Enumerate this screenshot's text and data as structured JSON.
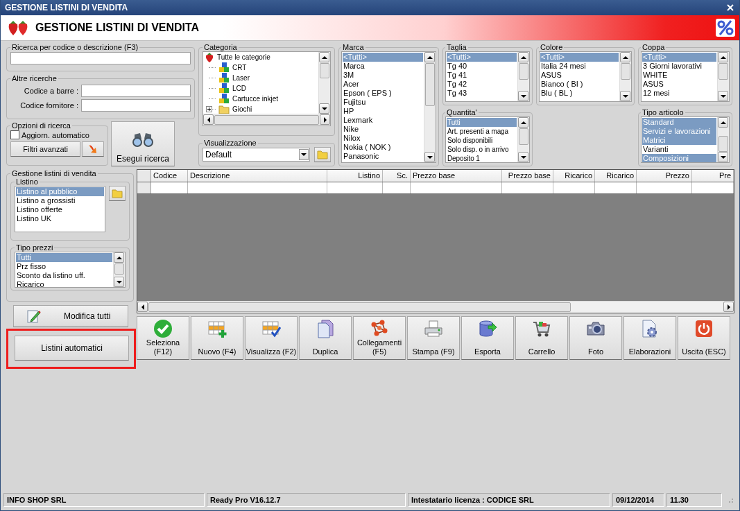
{
  "window": {
    "title": "GESTIONE LISTINI DI VENDITA"
  },
  "header": {
    "title": "GESTIONE LISTINI DI VENDITA"
  },
  "search": {
    "title": "Ricerca per codice o descrizione (F3)"
  },
  "other_searches": {
    "title": "Altre ricerche",
    "fields": [
      {
        "label": "Codice a barre :"
      },
      {
        "label": "Codice fornitore :"
      }
    ]
  },
  "search_options": {
    "title": "Opzioni di ricerca",
    "auto_update": {
      "label": "Aggiorn. automatico",
      "checked": false
    },
    "advanced_button": "Filtri avanzati"
  },
  "run_search_button": "Esegui ricerca",
  "category": {
    "title": "Categoria",
    "tree": {
      "label": "Tutte le categorie",
      "kind": "root",
      "children": [
        {
          "label": "CRT",
          "kind": "group"
        },
        {
          "label": "Laser",
          "kind": "group"
        },
        {
          "label": "LCD",
          "kind": "group"
        },
        {
          "label": "Cartucce inkjet",
          "kind": "group"
        },
        {
          "label": "Giochi",
          "kind": "folder"
        }
      ]
    }
  },
  "view": {
    "title": "Visualizzazione",
    "value": "Default"
  },
  "lists": [
    {
      "title": "Marca",
      "items": [
        {
          "label": "<Tutti>",
          "selected": true
        },
        {
          "label": "Marca",
          "selected": false
        },
        {
          "label": "3M",
          "selected": false
        },
        {
          "label": "Acer",
          "selected": false
        },
        {
          "label": "Epson ( EPS )",
          "selected": false
        },
        {
          "label": "Fujitsu",
          "selected": false
        },
        {
          "label": "HP",
          "selected": false
        },
        {
          "label": "Lexmark",
          "selected": false
        },
        {
          "label": "Nike",
          "selected": false
        },
        {
          "label": "Nilox",
          "selected": false
        },
        {
          "label": "Nokia ( NOK )",
          "selected": false
        },
        {
          "label": "Panasonic",
          "selected": false
        }
      ]
    },
    {
      "title": "Taglia",
      "items": [
        {
          "label": "<Tutti>",
          "selected": true
        },
        {
          "label": "Tg 40",
          "selected": false
        },
        {
          "label": "Tg 41",
          "selected": false
        },
        {
          "label": "Tg 42",
          "selected": false
        },
        {
          "label": "Tg 43",
          "selected": false
        }
      ]
    },
    {
      "title": "Colore",
      "items": [
        {
          "label": "<Tutti>",
          "selected": true
        },
        {
          "label": "Italia 24 mesi",
          "selected": false
        },
        {
          "label": "ASUS",
          "selected": false
        },
        {
          "label": "Bianco ( BI )",
          "selected": false
        },
        {
          "label": "Blu ( BL )",
          "selected": false
        }
      ]
    },
    {
      "title": "Coppa",
      "items": [
        {
          "label": "<Tutti>",
          "selected": true
        },
        {
          "label": "3 Giorni lavorativi",
          "selected": false
        },
        {
          "label": "WHITE",
          "selected": false
        },
        {
          "label": "ASUS",
          "selected": false
        },
        {
          "label": "12 mesi",
          "selected": false
        }
      ]
    },
    {
      "title": "Quantita'",
      "items": [
        {
          "label": "Tutti",
          "selected": true
        },
        {
          "label": "Art. presenti a maga",
          "selected": false
        },
        {
          "label": "Solo disponibili",
          "selected": false
        },
        {
          "label": "Solo disp. o in arrivo",
          "selected": false
        },
        {
          "label": "Deposito 1",
          "selected": false
        }
      ]
    },
    {
      "title": "Tipo articolo",
      "items": [
        {
          "label": "Standard",
          "selected": true
        },
        {
          "label": "Servizi e lavorazioni",
          "selected": true
        },
        {
          "label": "Matrici",
          "selected": true
        },
        {
          "label": "Varianti",
          "selected": false
        },
        {
          "label": "Composizioni",
          "selected": true
        }
      ]
    }
  ],
  "price_lists": {
    "title": "Gestione listini di vendita",
    "listino": {
      "title": "Listino",
      "items": [
        {
          "label": "Listino al pubblico",
          "selected": true
        },
        {
          "label": "Listino a grossisti",
          "selected": false
        },
        {
          "label": "Listino offerte",
          "selected": false
        },
        {
          "label": "Listino UK",
          "selected": false
        }
      ]
    },
    "price_types": {
      "title": "Tipo prezzi",
      "items": [
        {
          "label": "Tutti",
          "selected": true
        },
        {
          "label": "Prz fisso",
          "selected": false
        },
        {
          "label": "Sconto da listino uff.",
          "selected": false
        },
        {
          "label": "Ricarico",
          "selected": false
        }
      ]
    }
  },
  "edit_all_button": "Modifica tutti",
  "auto_lists_button": "Listini automatici",
  "table": {
    "columns": [
      "Codice",
      "Descrizione",
      "Listino",
      "Sc.",
      "Prezzo base",
      "Prezzo base",
      "Ricarico",
      "Ricarico",
      "Prezzo",
      "Pre"
    ]
  },
  "toolbar": [
    {
      "label": "Seleziona\n(F12)",
      "kind": "check"
    },
    {
      "label": "Nuovo (F4)",
      "kind": "add"
    },
    {
      "label": "Visualizza (F2)",
      "kind": "view"
    },
    {
      "label": "Duplica",
      "kind": "duplicate"
    },
    {
      "label": "Collegamenti\n(F5)",
      "kind": "links"
    },
    {
      "label": "Stampa (F9)",
      "kind": "print"
    },
    {
      "label": "Esporta",
      "kind": "export"
    },
    {
      "label": "Carrello",
      "kind": "cart"
    },
    {
      "label": "Foto",
      "kind": "photo"
    },
    {
      "label": "Elaborazioni",
      "kind": "process"
    },
    {
      "label": "Uscita (ESC)",
      "kind": "exit"
    }
  ],
  "status_bar": [
    "INFO SHOP SRL",
    "Ready Pro V16.12.7",
    "Intestatario licenza : CODICE SRL",
    "09/12/2014",
    "11.30"
  ]
}
